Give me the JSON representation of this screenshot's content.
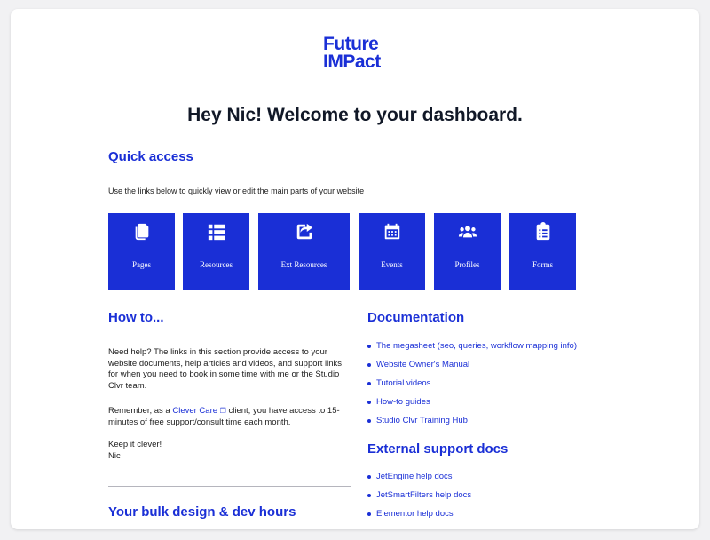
{
  "brand": {
    "line1": "Future",
    "line2": "IMPact",
    "color": "#1a2fd6"
  },
  "header": {
    "welcome": "Hey Nic! Welcome to your dashboard."
  },
  "quick_access": {
    "title": "Quick access",
    "intro": "Use the links below to quickly view or edit the main parts of your website",
    "tiles": [
      {
        "label": "Pages",
        "icon": "pages-icon"
      },
      {
        "label": "Resources",
        "icon": "list-icon"
      },
      {
        "label": "Ext Resources",
        "icon": "share-icon"
      },
      {
        "label": "Events",
        "icon": "calendar-icon"
      },
      {
        "label": "Profiles",
        "icon": "users-icon"
      },
      {
        "label": "Forms",
        "icon": "clipboard-icon"
      }
    ]
  },
  "howto": {
    "title": "How to...",
    "para1": "Need help? The links in this section provide access to your website documents, help articles and videos, and support links for when you need to book in some time with me or the Studio Clvr team.",
    "para2_before": "Remember, as a ",
    "para2_link": "Clever Care",
    "para2_link_icon": "❐",
    "para2_after": " client, you have access to 15-minutes of free support/consult time each month.",
    "signoff1": "Keep it clever!",
    "signoff2": "Nic"
  },
  "bulk": {
    "title": "Your bulk design & dev hours"
  },
  "documentation": {
    "title": "Documentation",
    "links": [
      "The megasheet (seo, queries, workflow mapping info)",
      "Website Owner's Manual",
      "Tutorial videos",
      "How-to guides",
      "Studio Clvr Training Hub"
    ]
  },
  "external": {
    "title": "External support docs",
    "links": [
      "JetEngine help docs",
      "JetSmartFilters help docs",
      "Elementor help docs"
    ]
  }
}
